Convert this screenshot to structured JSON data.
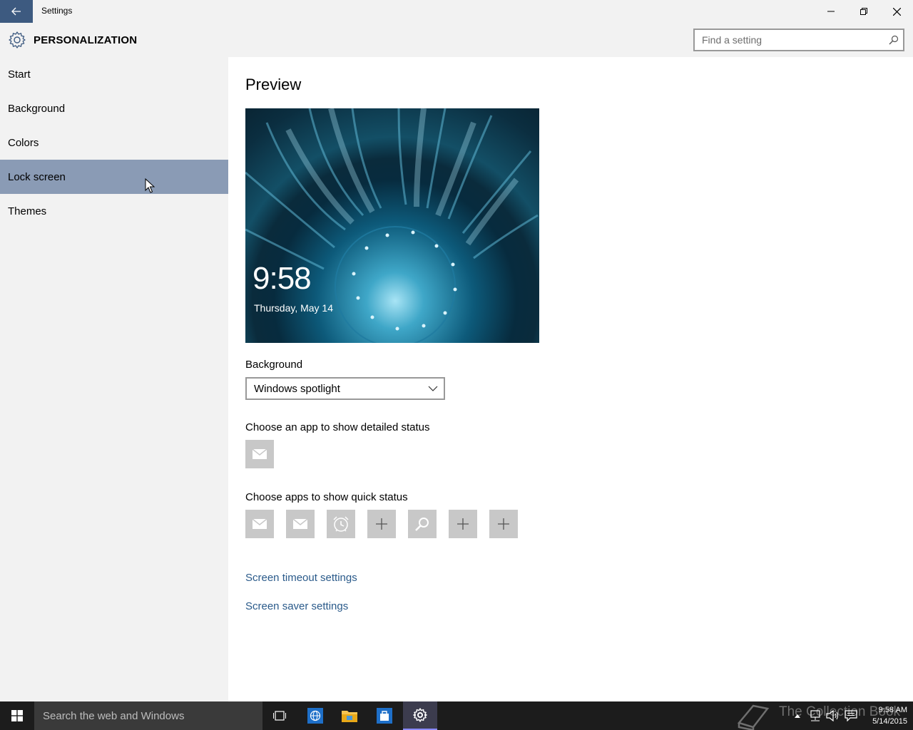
{
  "window": {
    "title": "Settings",
    "back_icon": "back-arrow-icon",
    "controls": [
      "minimize-icon",
      "restore-icon",
      "close-icon"
    ]
  },
  "header": {
    "icon": "gear-icon",
    "title": "PERSONALIZATION",
    "search_placeholder": "Find a setting"
  },
  "sidebar": {
    "items": [
      {
        "label": "Start",
        "active": false
      },
      {
        "label": "Background",
        "active": false
      },
      {
        "label": "Colors",
        "active": false
      },
      {
        "label": "Lock screen",
        "active": true
      },
      {
        "label": "Themes",
        "active": false
      }
    ]
  },
  "main": {
    "preview_title": "Preview",
    "preview": {
      "time": "9:58",
      "date": "Thursday, May 14"
    },
    "background_label": "Background",
    "background_value": "Windows spotlight",
    "detailed_status_label": "Choose an app to show detailed status",
    "detailed_status_app": "mail-icon",
    "quick_status_label": "Choose apps to show quick status",
    "quick_status_apps": [
      "mail-icon",
      "mail-icon",
      "alarm-icon",
      "plus-icon",
      "search-icon",
      "plus-icon",
      "plus-icon"
    ],
    "links": {
      "screen_timeout": "Screen timeout settings",
      "screen_saver": "Screen saver settings"
    }
  },
  "taskbar": {
    "search_placeholder": "Search the web and Windows",
    "watermark": "The Collection Book",
    "time": "9:58 AM",
    "date": "5/14/2015"
  },
  "colors": {
    "accent": "#3d5a80",
    "sidebar_active": "#8a9bb5",
    "link": "#2a5a8a",
    "tile": "#c8c8c8",
    "taskbar": "#1c1c1c"
  }
}
